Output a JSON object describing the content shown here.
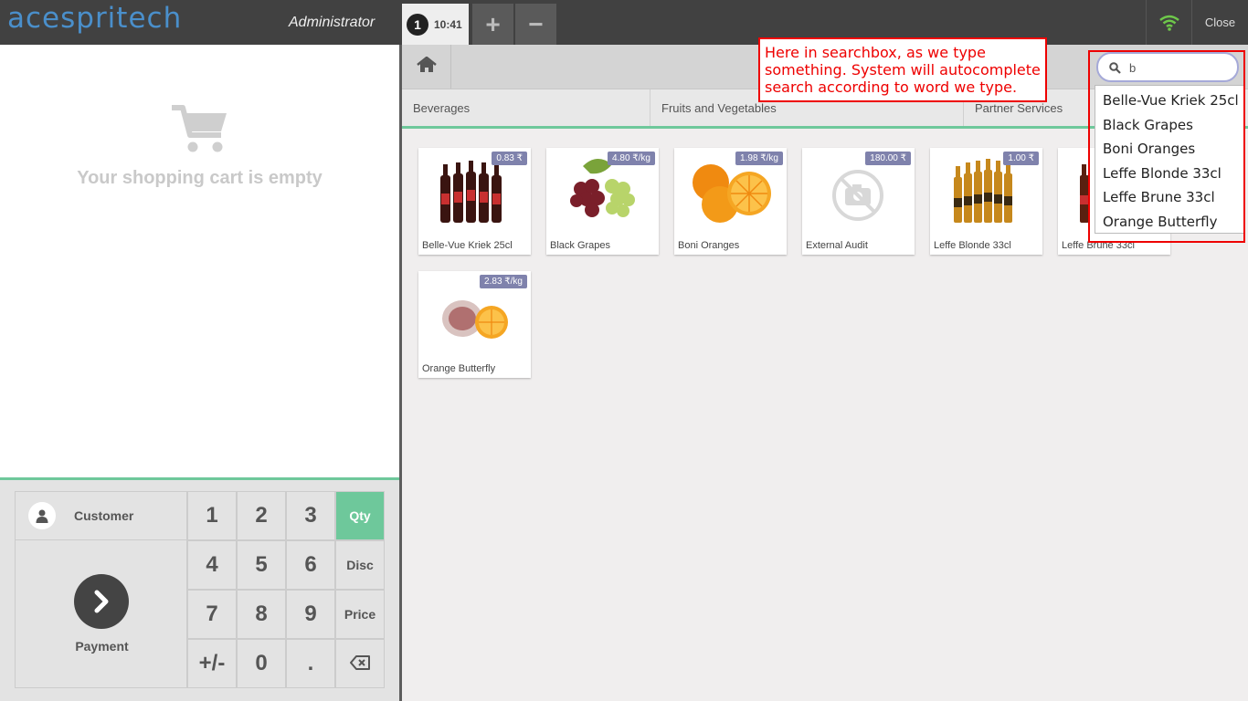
{
  "header": {
    "logo": "acespritech",
    "user": "Administrator",
    "order_number": "1",
    "order_time": "10:41",
    "add_order_label": "+",
    "remove_order_label": "−",
    "close_label": "Close"
  },
  "cart": {
    "empty_text": "Your shopping cart is empty"
  },
  "numpad": {
    "customer_label": "Customer",
    "payment_label": "Payment",
    "keys": [
      "1",
      "2",
      "3",
      "4",
      "5",
      "6",
      "7",
      "8",
      "9",
      "+/-",
      "0",
      "."
    ],
    "modes": [
      "Qty",
      "Disc",
      "Price"
    ],
    "active_mode": "Qty"
  },
  "categories": [
    "Beverages",
    "Fruits and Vegetables",
    "Partner Services"
  ],
  "products": [
    {
      "name": "Belle-Vue Kriek 25cl",
      "price": "0.83 ₹"
    },
    {
      "name": "Black Grapes",
      "price": "4.80 ₹/kg"
    },
    {
      "name": "Boni Oranges",
      "price": "1.98 ₹/kg"
    },
    {
      "name": "External Audit",
      "price": "180.00 ₹"
    },
    {
      "name": "Leffe Blonde 33cl",
      "price": "1.00 ₹"
    },
    {
      "name": "Leffe Brune 33cl",
      "price": ""
    },
    {
      "name": "Orange Butterfly",
      "price": "2.83 ₹/kg"
    }
  ],
  "search": {
    "value": "b",
    "suggestions": [
      "Belle-Vue Kriek 25cl",
      "Black Grapes",
      "Boni Oranges",
      "Leffe Blonde 33cl",
      "Leffe Brune 33cl",
      "Orange Butterfly"
    ]
  },
  "annotation": {
    "text": "Here in searchbox, as we type something. System will autocomplete search according to word we type."
  },
  "colors": {
    "accent": "#6ec89b",
    "price_tag": "#7f82ac",
    "annotation": "#ee0000"
  }
}
